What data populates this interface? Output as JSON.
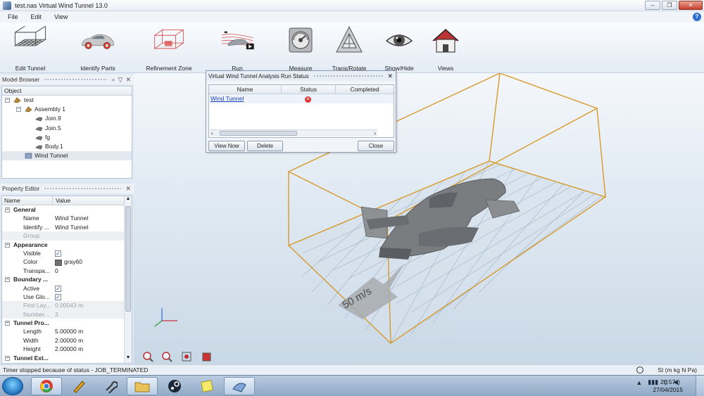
{
  "window": {
    "title": "test.nas Virtual Wind Tunnel 13.0"
  },
  "menu": [
    "File",
    "Edit",
    "View"
  ],
  "ribbon": [
    {
      "label": "Edit Tunnel",
      "icon": "tunnel-grid-icon"
    },
    {
      "label": "Identify Parts",
      "icon": "car-parts-icon"
    },
    {
      "label": "Refinement Zone",
      "icon": "refinement-box-icon"
    },
    {
      "label": "Run",
      "icon": "run-icon"
    },
    {
      "label": "Measure",
      "icon": "measure-icon"
    },
    {
      "label": "Trans/Rotate",
      "icon": "transform-icon"
    },
    {
      "label": "Show/Hide",
      "icon": "eye-icon"
    },
    {
      "label": "Views",
      "icon": "house-icon"
    }
  ],
  "model_browser": {
    "title": "Model Browser",
    "column": "Object",
    "tree": [
      {
        "label": "test",
        "level": 0,
        "expander": "−"
      },
      {
        "label": "Assembly 1",
        "level": 1,
        "expander": "−"
      },
      {
        "label": "Join.9",
        "level": 2
      },
      {
        "label": "Join.5",
        "level": 2
      },
      {
        "label": "fg",
        "level": 2
      },
      {
        "label": "Body.1",
        "level": 2
      },
      {
        "label": "Wind Tunnel",
        "level": 1,
        "selected": true
      }
    ]
  },
  "property_editor": {
    "title": "Property Editor",
    "col_name": "Name",
    "col_value": "Value",
    "rows": [
      {
        "type": "cat",
        "name": "General"
      },
      {
        "name": "Name",
        "value": "Wind Tunnel"
      },
      {
        "name": "Identify ...",
        "value": "Wind Tunnel"
      },
      {
        "name": "Group",
        "value": "",
        "dim": true
      },
      {
        "type": "cat",
        "name": "Appearance"
      },
      {
        "name": "Visible",
        "check": true
      },
      {
        "name": "Color",
        "value": "gray60",
        "swatch": true
      },
      {
        "name": "Transpa...",
        "value": "0"
      },
      {
        "type": "cat",
        "name": "Boundary ..."
      },
      {
        "name": "Active",
        "check": true
      },
      {
        "name": "Use Glo...",
        "check": true
      },
      {
        "name": "First Lay...",
        "value": "0.00043 m",
        "dim": true
      },
      {
        "name": "Number...",
        "value": "3",
        "dim": true
      },
      {
        "type": "cat",
        "name": "Tunnel Pro..."
      },
      {
        "name": "Length",
        "value": "5.00000 m"
      },
      {
        "name": "Width",
        "value": "2.00000 m"
      },
      {
        "name": "Height",
        "value": "2.00000 m"
      },
      {
        "type": "cat",
        "name": "Tunnel Ext..."
      }
    ]
  },
  "dialog": {
    "title": "Virtual Wind Tunnel Analysis Run Status",
    "columns": [
      "Name",
      "Status",
      "Completed"
    ],
    "row": {
      "name": "Wind Tunnel",
      "status": "error",
      "completed": ""
    },
    "buttons": {
      "view_now": "View Now",
      "delete": "Delete",
      "close": "Close"
    }
  },
  "viewport": {
    "speed_label": "50 m/s"
  },
  "status": {
    "message": "Timer stopped because of status - JOB_TERMINATED",
    "units": "SI (m kg N Pa)"
  },
  "taskbar": {
    "time": "20:57",
    "date": "27/04/2015"
  },
  "colors": {
    "tunnel_box": "#d79a2a",
    "floor_grid": "#9fb3c8",
    "accent": "#2f6fd0"
  }
}
